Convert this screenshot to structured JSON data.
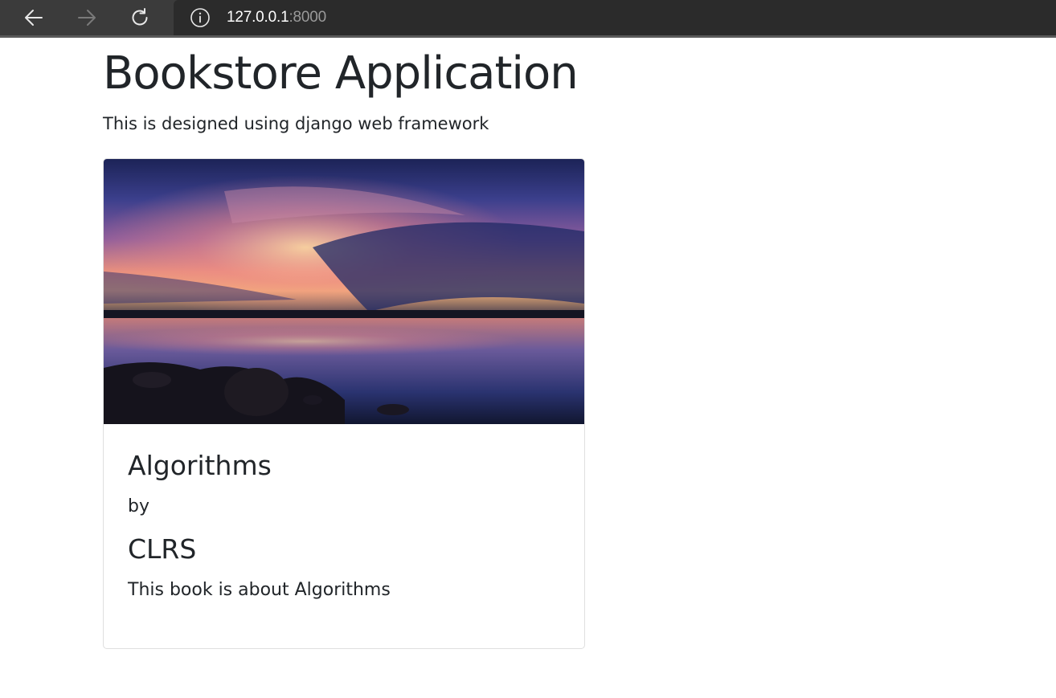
{
  "browser": {
    "url_host": "127.0.0.1",
    "url_port": ":8000",
    "icons": {
      "back": "back-arrow-icon",
      "forward": "forward-arrow-icon",
      "reload": "reload-icon",
      "info": "info-icon"
    }
  },
  "page": {
    "title": "Bookstore Application",
    "subtitle": "This is designed using django web framework"
  },
  "book": {
    "title": "Algorithms",
    "by_label": "by",
    "author": "CLRS",
    "description": "This book is about Algorithms"
  },
  "colors": {
    "chrome_bg": "#3b3b3b",
    "address_bg": "#2b2b2b",
    "text": "#212529",
    "card_border": "#dfdfdf"
  }
}
